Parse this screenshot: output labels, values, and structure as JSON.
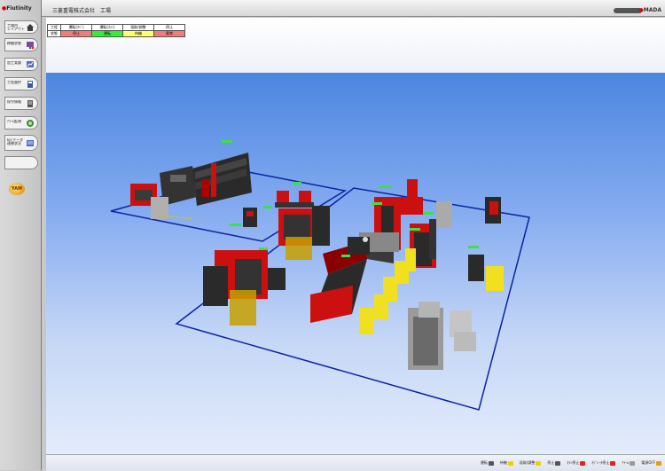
{
  "app": {
    "logo_prefix": "●",
    "logo_text": "Fiutinity",
    "title": "三菱重電株式会社　工場",
    "brand_a": "●",
    "brand_rest": "MADA"
  },
  "sidebar": {
    "items": [
      {
        "label": "工場内\nレイアウト",
        "icon": "home-icon",
        "color": "#3c3c3c"
      },
      {
        "label": "稼働状態",
        "icon": "monitor-icon",
        "color": "#7a4aa0"
      },
      {
        "label": "加工実績",
        "icon": "chart-icon",
        "color": "#5a6ab8"
      },
      {
        "label": "工程進捗",
        "icon": "progress-icon",
        "color": "#3a5aa8"
      },
      {
        "label": "保守情報",
        "icon": "document-icon",
        "color": "#555555"
      },
      {
        "label": "ｱﾗｰﾑ監視",
        "icon": "alarm-icon",
        "color": "#3a8a3a"
      },
      {
        "label": "IoTデータ\n連携状況",
        "icon": "data-icon",
        "color": "#4a6ac8"
      }
    ],
    "badge": "YAM"
  },
  "status_table": {
    "header": [
      "工程",
      "運転(ｵﾍﾟ)",
      "運転(ｵﾗﾝ)",
      "段取/調整",
      "停止"
    ],
    "row": [
      "状態",
      "停止",
      "運転",
      "待機",
      "異常"
    ],
    "colors": [
      "#ffffff",
      "#f47a7a",
      "#33ee33",
      "#ffff66",
      "#f47a7a"
    ]
  },
  "legend": [
    {
      "label": "運転",
      "color": "#555555"
    },
    {
      "label": "待機",
      "color": "#f0d000"
    },
    {
      "label": "段取/調整",
      "color": "#f0d000"
    },
    {
      "label": "停止",
      "color": "#555555"
    },
    {
      "label": "ｵﾗﾝ停止",
      "color": "#dd2222"
    },
    {
      "label": "ｵﾍﾟﾚｰﾀ停止",
      "color": "#dd2222"
    },
    {
      "label": "ｱﾗｰﾑ",
      "color": "#999999"
    },
    {
      "label": "電源OFF",
      "color": "#e8a000"
    }
  ]
}
